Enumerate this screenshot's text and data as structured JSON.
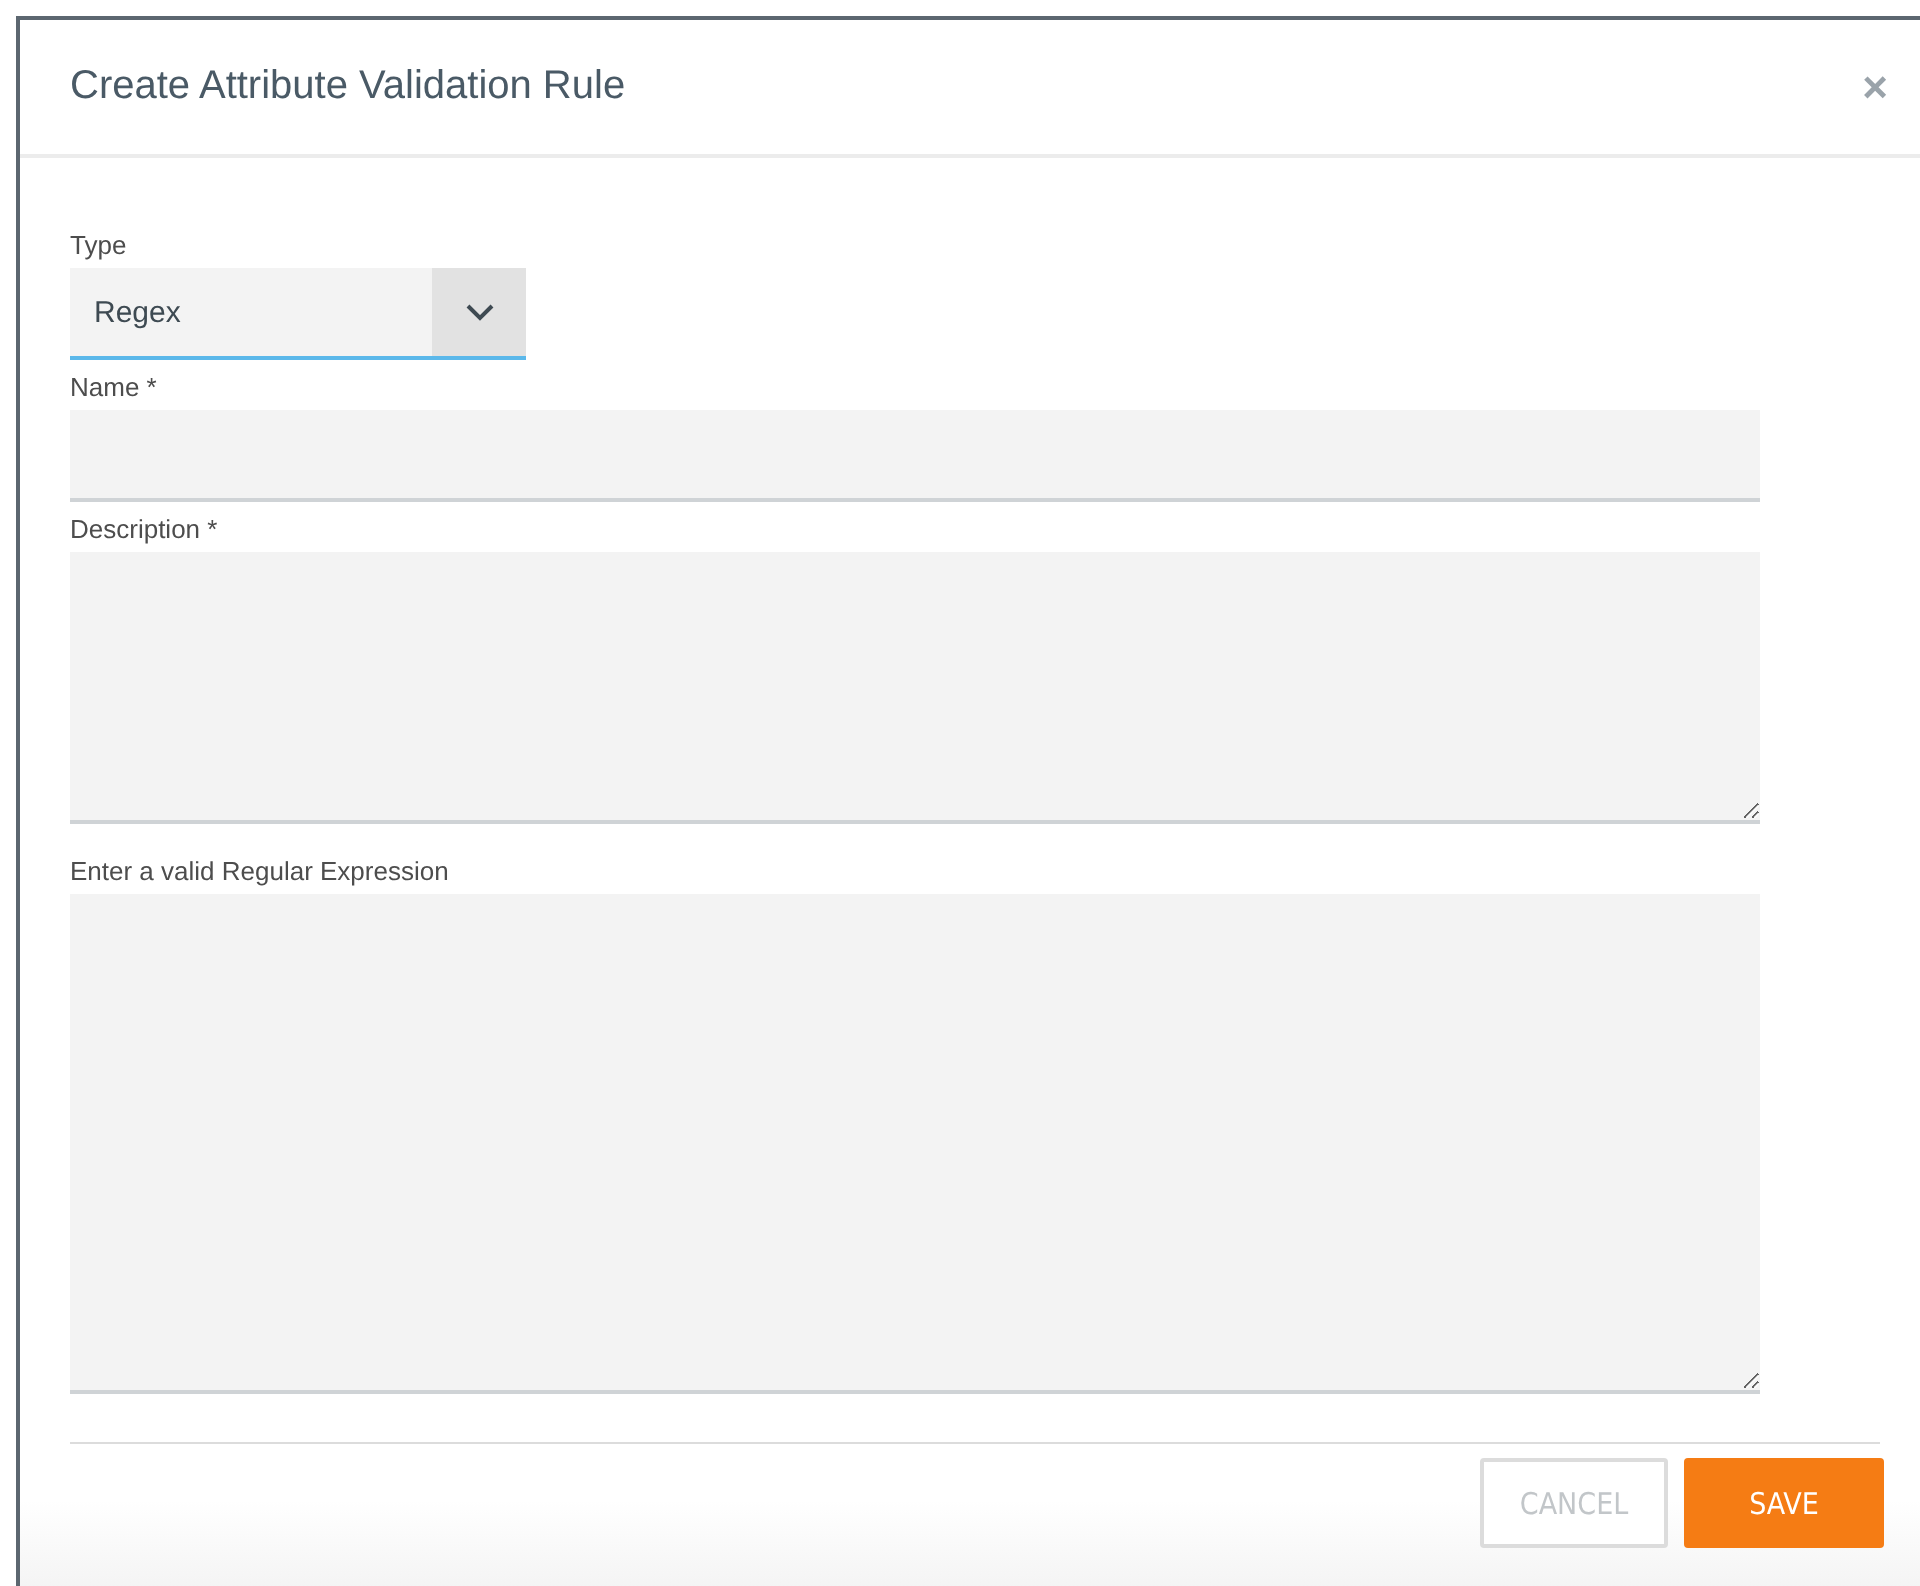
{
  "dialog": {
    "title": "Create Attribute Validation Rule",
    "close": "×"
  },
  "fields": [
    {
      "kind": "select",
      "label": "Type",
      "value": "Regex",
      "focused": true
    },
    {
      "kind": "input",
      "label": "Name *"
    },
    {
      "kind": "textarea",
      "label": "Description *"
    },
    {
      "kind": "textarea",
      "label": "Enter a valid Regular Expression"
    }
  ],
  "buttons": [
    {
      "label": "CANCEL",
      "kind": "secondary",
      "disabled": true
    },
    {
      "label": "SAVE",
      "kind": "primary",
      "disabled": false
    }
  ]
}
